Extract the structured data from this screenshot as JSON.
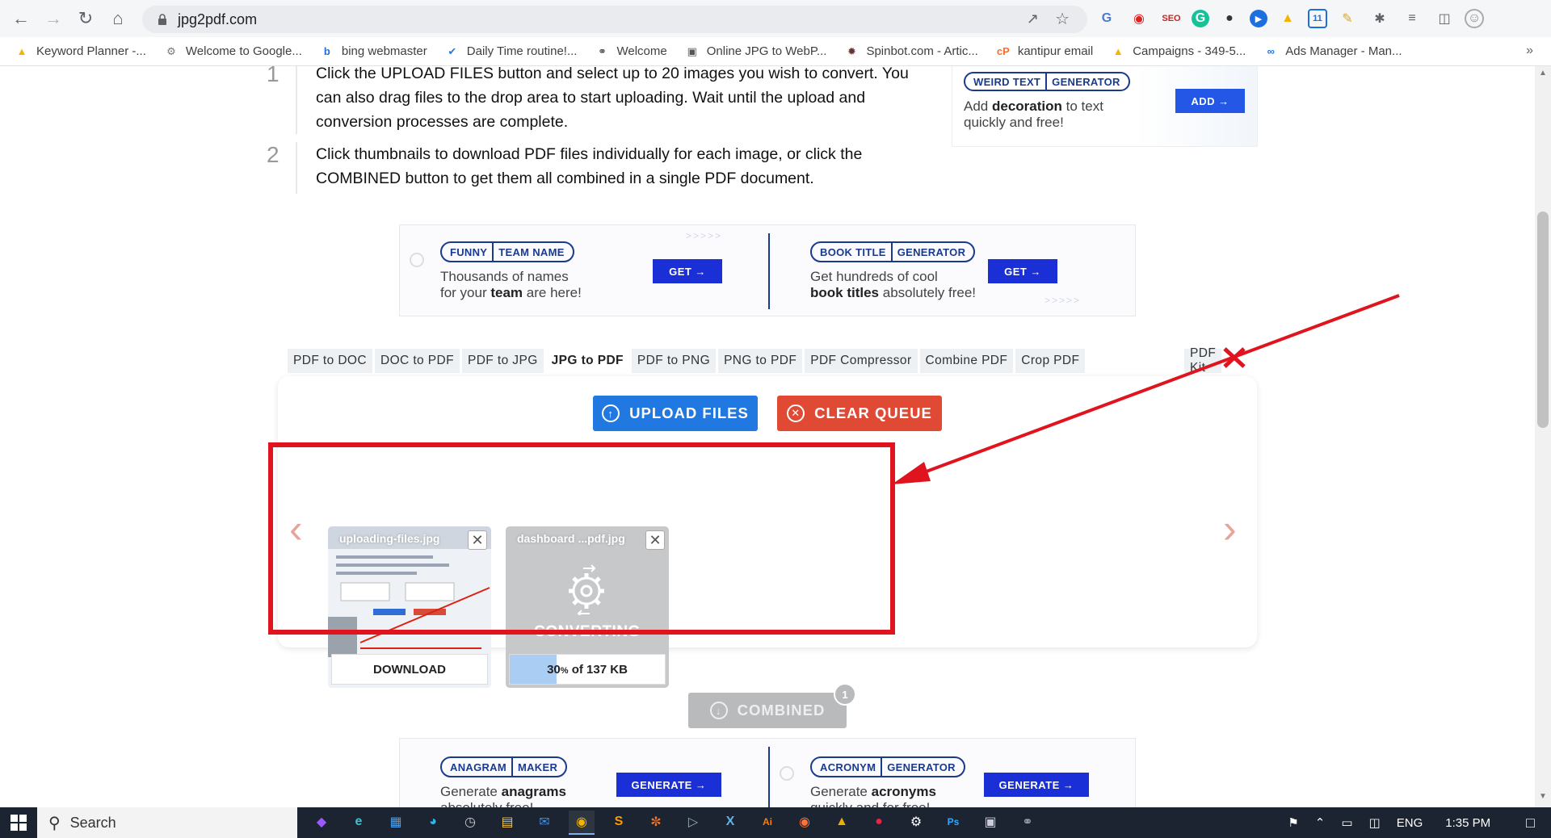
{
  "browser": {
    "url": "jpg2pdf.com",
    "bookmarks": [
      "Keyword Planner -...",
      "Welcome to Google...",
      "bing webmaster",
      "Daily Time routine!...",
      "Welcome",
      "Online JPG to WebP...",
      "Spinbot.com - Artic...",
      "kantipur email",
      "Campaigns - 349-5...",
      "Ads Manager - Man..."
    ],
    "bookmarks_more": "»"
  },
  "steps": [
    {
      "num": "1",
      "text": "Click the UPLOAD FILES button and select up to 20 images you wish to convert. You can also drag files to the drop area to start uploading. Wait until the upload and conversion processes are complete."
    },
    {
      "num": "2",
      "text": "Click thumbnails to download PDF files individually for each image, or click the COMBINED button to get them all combined in a single PDF document."
    }
  ],
  "ads": {
    "weird": {
      "tag_a": "WEIRD TEXT",
      "tag_b": "GENERATOR",
      "line1_b": "decoration",
      "line1_pre": "Add ",
      "line1_post": " to text",
      "line2": "quickly and free!",
      "btn": "ADD →"
    },
    "team": {
      "tag_a": "FUNNY",
      "tag_b": "TEAM NAME",
      "line1": "Thousands of names",
      "line2_pre": "for your ",
      "line2_b": "team",
      "line2_post": " are here!",
      "btn": "GET →"
    },
    "book": {
      "tag_a": "BOOK TITLE",
      "tag_b": "GENERATOR",
      "line1": "Get hundreds of cool",
      "line2_b": "book titles",
      "line2_post": " absolutely free!",
      "btn": "GET →"
    },
    "anagram": {
      "tag_a": "ANAGRAM",
      "tag_b": "MAKER",
      "line1_pre": "Generate ",
      "line1_b": "anagrams",
      "line2": "absolutely free!",
      "btn": "GENERATE →"
    },
    "acronym": {
      "tag_a": "ACRONYM",
      "tag_b": "GENERATOR",
      "line1_pre": "Generate ",
      "line1_b": "acronyms",
      "line2": "quickly and for free!",
      "btn": "GENERATE →"
    }
  },
  "tabs": [
    "PDF to DOC",
    "DOC to PDF",
    "PDF to JPG",
    "JPG to PDF",
    "PDF to PNG",
    "PNG to PDF",
    "PDF Compressor",
    "Combine PDF",
    "Crop PDF"
  ],
  "tab_right": "PDF Kit",
  "active_tab": "JPG to PDF",
  "tool": {
    "upload_label": "UPLOAD FILES",
    "clear_label": "CLEAR QUEUE",
    "combined_label": "COMBINED",
    "combined_count": "1",
    "prev": "‹",
    "next": "›",
    "files": [
      {
        "name": "uploading-files.jpg",
        "status": "DOWNLOAD"
      },
      {
        "name": "dashboard ...pdf.jpg",
        "status": "CONVERTING",
        "progress_pct": 30,
        "progress_text": "30",
        "progress_unit": "%",
        "progress_suffix": " of 137 KB"
      }
    ]
  },
  "taskbar": {
    "search": "Search",
    "lang": "ENG",
    "time": "1:35 PM"
  },
  "colors": {
    "upload": "#2178e0",
    "clear": "#e04a34",
    "highlight": "#e0141e",
    "ad_blue": "#1a3a8c"
  }
}
